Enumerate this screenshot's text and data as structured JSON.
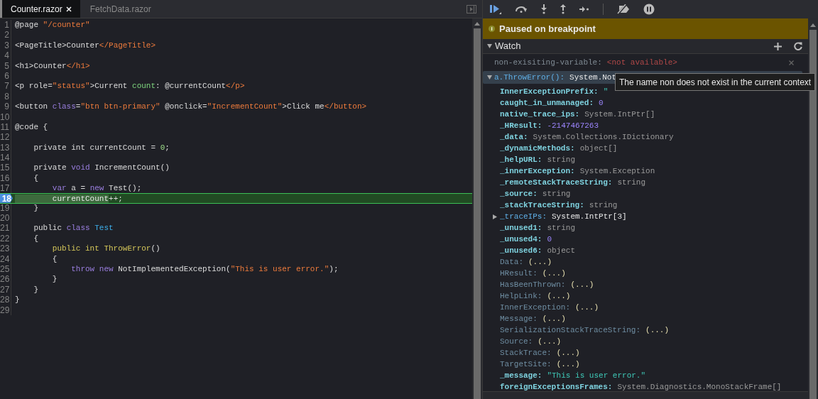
{
  "editor": {
    "tabs": [
      {
        "label": "Counter.razor",
        "selected": true,
        "closable": true
      },
      {
        "label": "FetchData.razor",
        "selected": false,
        "closable": false
      }
    ],
    "lines": [
      {
        "number": "1",
        "current": false,
        "tokens": [
          {
            "kind": "p",
            "text": "@page "
          },
          {
            "kind": "s",
            "text": "\"/counter\""
          }
        ]
      },
      {
        "number": "2",
        "current": false
      },
      {
        "number": "3",
        "current": false,
        "tokens": [
          {
            "kind": "p",
            "text": "<PageTitle>Counter"
          },
          {
            "kind": "s",
            "text": "</PageTitle>"
          }
        ]
      },
      {
        "number": "4",
        "current": false
      },
      {
        "number": "5",
        "current": false,
        "tokens": [
          {
            "kind": "p",
            "text": "<h1>Counter"
          },
          {
            "kind": "s",
            "text": "</h1>"
          }
        ]
      },
      {
        "number": "6",
        "current": false
      },
      {
        "number": "7",
        "current": false,
        "tokens": [
          {
            "kind": "p",
            "text": "<p role="
          },
          {
            "kind": "s",
            "text": "\"status\""
          },
          {
            "kind": "p",
            "text": ">Current "
          },
          {
            "kind": "g",
            "text": "count"
          },
          {
            "kind": "p",
            "text": ": @currentCount"
          },
          {
            "kind": "s",
            "text": "</p>"
          }
        ]
      },
      {
        "number": "8",
        "current": false
      },
      {
        "number": "9",
        "current": false,
        "tokens": [
          {
            "kind": "p",
            "text": "<button "
          },
          {
            "kind": "k",
            "text": "class"
          },
          {
            "kind": "p",
            "text": "="
          },
          {
            "kind": "s",
            "text": "\"btn btn-primary\""
          },
          {
            "kind": "p",
            "text": " @onclick="
          },
          {
            "kind": "s",
            "text": "\"IncrementCount\""
          },
          {
            "kind": "p",
            "text": ">Click me"
          },
          {
            "kind": "s",
            "text": "</button>"
          }
        ]
      },
      {
        "number": "10",
        "current": false
      },
      {
        "number": "11",
        "current": false,
        "tokens": [
          {
            "kind": "p",
            "text": "@code {"
          }
        ]
      },
      {
        "number": "12",
        "current": false
      },
      {
        "number": "13",
        "current": false,
        "tokens": [
          {
            "kind": "p",
            "text": "    private int currentCount = "
          },
          {
            "kind": "n",
            "text": "0"
          },
          {
            "kind": "p",
            "text": ";"
          }
        ]
      },
      {
        "number": "14",
        "current": false
      },
      {
        "number": "15",
        "current": false,
        "tokens": [
          {
            "kind": "p",
            "text": "    private "
          },
          {
            "kind": "k",
            "text": "void"
          },
          {
            "kind": "p",
            "text": " IncrementCount()"
          }
        ]
      },
      {
        "number": "16",
        "current": false,
        "tokens": [
          {
            "kind": "p",
            "text": "    {"
          }
        ]
      },
      {
        "number": "17",
        "current": false,
        "tokens": [
          {
            "kind": "k",
            "text": "        var"
          },
          {
            "kind": "p",
            "text": " a = "
          },
          {
            "kind": "k",
            "text": "new"
          },
          {
            "kind": "p",
            "text": " Test();"
          }
        ]
      },
      {
        "number": "18",
        "current": true,
        "tokens": [
          {
            "kind": "h",
            "text": "        currentCount"
          },
          {
            "kind": "p",
            "text": "++;"
          }
        ]
      },
      {
        "number": "19",
        "current": false,
        "tokens": [
          {
            "kind": "p",
            "text": "    }"
          }
        ]
      },
      {
        "number": "20",
        "current": false
      },
      {
        "number": "21",
        "current": false,
        "tokens": [
          {
            "kind": "p",
            "text": "    public "
          },
          {
            "kind": "k",
            "text": "class"
          },
          {
            "kind": "c",
            "text": " Test"
          }
        ]
      },
      {
        "number": "22",
        "current": false,
        "tokens": [
          {
            "kind": "p",
            "text": "    {"
          }
        ]
      },
      {
        "number": "23",
        "current": false,
        "tokens": [
          {
            "kind": "m",
            "text": "        public int ThrowError"
          },
          {
            "kind": "p",
            "text": "()"
          }
        ]
      },
      {
        "number": "24",
        "current": false,
        "tokens": [
          {
            "kind": "p",
            "text": "        {"
          }
        ]
      },
      {
        "number": "25",
        "current": false,
        "tokens": [
          {
            "kind": "k",
            "text": "            throw"
          },
          {
            "kind": "k",
            "text": " new"
          },
          {
            "kind": "p",
            "text": " NotImplementedException("
          },
          {
            "kind": "s",
            "text": "\"This is user error.\""
          },
          {
            "kind": "p",
            "text": ");"
          }
        ]
      },
      {
        "number": "26",
        "current": false,
        "tokens": [
          {
            "kind": "p",
            "text": "        }"
          }
        ]
      },
      {
        "number": "27",
        "current": false,
        "tokens": [
          {
            "kind": "p",
            "text": "    }"
          }
        ]
      },
      {
        "number": "28",
        "current": false,
        "tokens": [
          {
            "kind": "p",
            "text": "}"
          }
        ]
      },
      {
        "number": "29",
        "current": false
      }
    ]
  },
  "debugger": {
    "banner": {
      "icon": "i",
      "text": "Paused on breakpoint"
    },
    "watch": {
      "title": "Watch",
      "expanded": true,
      "items": [
        {
          "kind": "error",
          "name": "non-exisiting-variable:",
          "value": {
            "kind": "error",
            "text": "<not available>"
          },
          "selected": false
        },
        {
          "kind": "group",
          "name": "a.ThrowError():",
          "value": {
            "kind": "plain",
            "text": "System.Not"
          },
          "expanded": true,
          "selected": true,
          "children": [
            {
              "kind": "field",
              "name": "InnerExceptionPrefix:",
              "value": {
                "kind": "string",
                "text": "\""
              }
            },
            {
              "kind": "field",
              "name": "caught_in_unmanaged:",
              "value": {
                "kind": "number",
                "text": "0"
              }
            },
            {
              "kind": "field",
              "name": "native_trace_ips:",
              "value": {
                "kind": "type",
                "text": "System.IntPtr[]"
              }
            },
            {
              "kind": "field",
              "name": "_HResult:",
              "value": {
                "kind": "number",
                "text": "-2147467263"
              }
            },
            {
              "kind": "field",
              "name": "_data:",
              "value": {
                "kind": "type",
                "text": "System.Collections.IDictionary"
              }
            },
            {
              "kind": "field",
              "name": "_dynamicMethods:",
              "value": {
                "kind": "type",
                "text": "object[]"
              }
            },
            {
              "kind": "field",
              "name": "_helpURL:",
              "value": {
                "kind": "type",
                "text": "string"
              }
            },
            {
              "kind": "field",
              "name": "_innerException:",
              "value": {
                "kind": "type",
                "text": "System.Exception"
              }
            },
            {
              "kind": "field",
              "name": "_remoteStackTraceString:",
              "value": {
                "kind": "type",
                "text": "string"
              }
            },
            {
              "kind": "field",
              "name": "_source:",
              "value": {
                "kind": "type",
                "text": "string"
              }
            },
            {
              "kind": "field",
              "name": "_stackTraceString:",
              "value": {
                "kind": "type",
                "text": "string"
              }
            },
            {
              "kind": "group",
              "name": "_traceIPs:",
              "value": {
                "kind": "plain",
                "text": "System.IntPtr[3]"
              },
              "expanded": false
            },
            {
              "kind": "field",
              "name": "_unused1:",
              "value": {
                "kind": "type",
                "text": "string"
              }
            },
            {
              "kind": "field",
              "name": "_unused4:",
              "value": {
                "kind": "number",
                "text": "0"
              }
            },
            {
              "kind": "field",
              "name": "_unused6:",
              "value": {
                "kind": "type",
                "text": "object"
              }
            },
            {
              "kind": "property",
              "name": "Data:",
              "value": {
                "kind": "lazy",
                "text": "(...)"
              }
            },
            {
              "kind": "property",
              "name": "HResult:",
              "value": {
                "kind": "lazy",
                "text": "(...)"
              }
            },
            {
              "kind": "property",
              "name": "HasBeenThrown:",
              "value": {
                "kind": "lazy",
                "text": "(...)"
              }
            },
            {
              "kind": "property",
              "name": "HelpLink:",
              "value": {
                "kind": "lazy",
                "text": "(...)"
              }
            },
            {
              "kind": "property",
              "name": "InnerException:",
              "value": {
                "kind": "lazy",
                "text": "(...)"
              }
            },
            {
              "kind": "property",
              "name": "Message:",
              "value": {
                "kind": "lazy",
                "text": "(...)"
              }
            },
            {
              "kind": "property",
              "name": "SerializationStackTraceString:",
              "value": {
                "kind": "lazy",
                "text": "(...)"
              }
            },
            {
              "kind": "property",
              "name": "Source:",
              "value": {
                "kind": "lazy",
                "text": "(...)"
              }
            },
            {
              "kind": "property",
              "name": "StackTrace:",
              "value": {
                "kind": "lazy",
                "text": "(...)"
              }
            },
            {
              "kind": "property",
              "name": "TargetSite:",
              "value": {
                "kind": "lazy",
                "text": "(...)"
              }
            },
            {
              "kind": "field",
              "name": "_message:",
              "value": {
                "kind": "string",
                "text": "\"This is user error.\""
              }
            },
            {
              "kind": "field",
              "name": "foreignExceptionsFrames:",
              "value": {
                "kind": "type",
                "text": "System.Diagnostics.MonoStackFrame[]"
              }
            }
          ]
        }
      ]
    },
    "tooltip": "The name non does not exist in the current context"
  }
}
